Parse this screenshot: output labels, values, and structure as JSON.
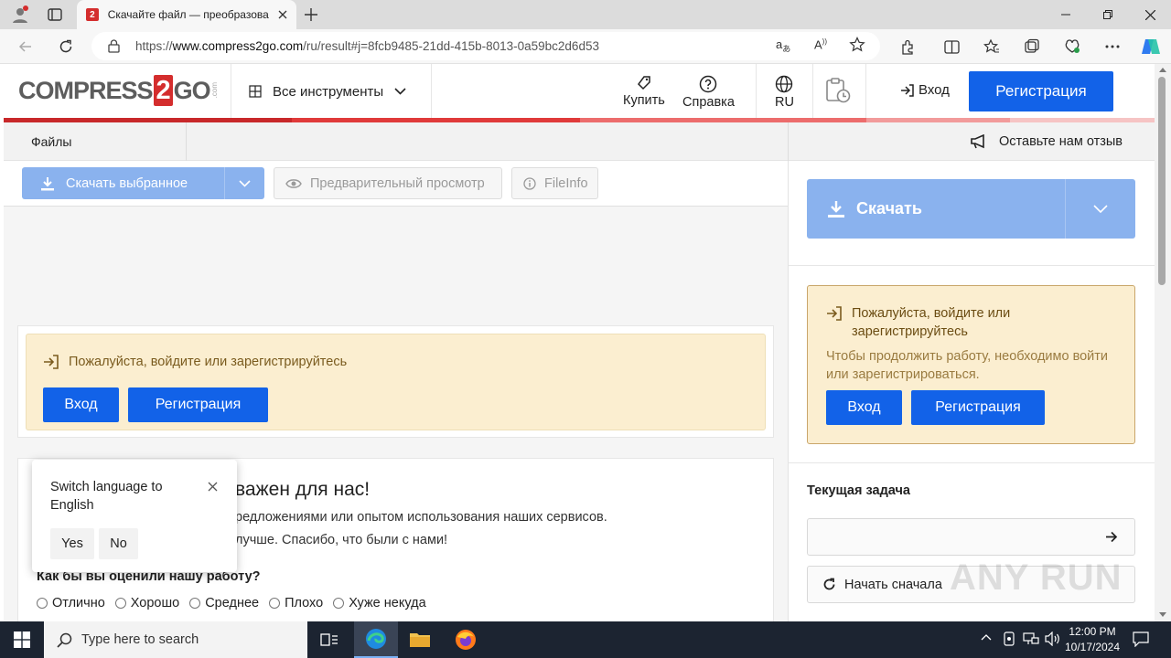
{
  "browser": {
    "tab_title": "Скачайте файл — преобразова",
    "url_prefix": "https://",
    "url_host": "www.compress2go.com",
    "url_path": "/ru/result#j=8fcb9485-21dd-415b-8013-0a59bc2d6d53"
  },
  "header": {
    "logo_part1": "COMPRESS",
    "logo_part2": "2",
    "logo_part3": "GO",
    "logo_suffix": ".com",
    "all_tools": "Все инструменты",
    "buy": "Купить",
    "help": "Справка",
    "lang": "RU",
    "login": "Вход",
    "register": "Регистрация"
  },
  "subbar": {
    "files_tab": "Файлы",
    "feedback": "Оставьте нам отзыв"
  },
  "toolbar": {
    "download_selected": "Скачать выбранное",
    "preview": "Предварительный просмотр",
    "fileinfo": "FileInfo"
  },
  "left_login": {
    "message": "Пожалуйста, войдите или зарегистрируйтесь",
    "login": "Вход",
    "register": "Регистрация"
  },
  "rating": {
    "heading_visible": "важен для нас!",
    "line1_visible": "редложениями или опытом использования наших сервисов.",
    "line2_visible": "лучше. Спасибо, что были с нами!",
    "question": "Как бы вы оценили нашу работу?",
    "options": [
      "Отлично",
      "Хорошо",
      "Среднее",
      "Плохо",
      "Хуже некуда"
    ]
  },
  "popup": {
    "text": "Switch language to English",
    "yes": "Yes",
    "no": "No"
  },
  "right": {
    "download": "Скачать",
    "login_title": "Пожалуйста, войдите или зарегистрируйтесь",
    "login_desc": "Чтобы продолжить работу, необходимо войти или зарегистрироваться.",
    "login": "Вход",
    "register": "Регистрация",
    "current_task": "Текущая задача",
    "restart": "Начать сначала"
  },
  "taskbar": {
    "search_placeholder": "Type here to search",
    "time": "12:00 PM",
    "date": "10/17/2024"
  },
  "watermark": "ANY RUN",
  "colors": {
    "brand_red": "#d42d2d",
    "primary_blue": "#1262e8",
    "light_blue": "#8ab2ee",
    "warning_bg": "#fbeed0"
  }
}
